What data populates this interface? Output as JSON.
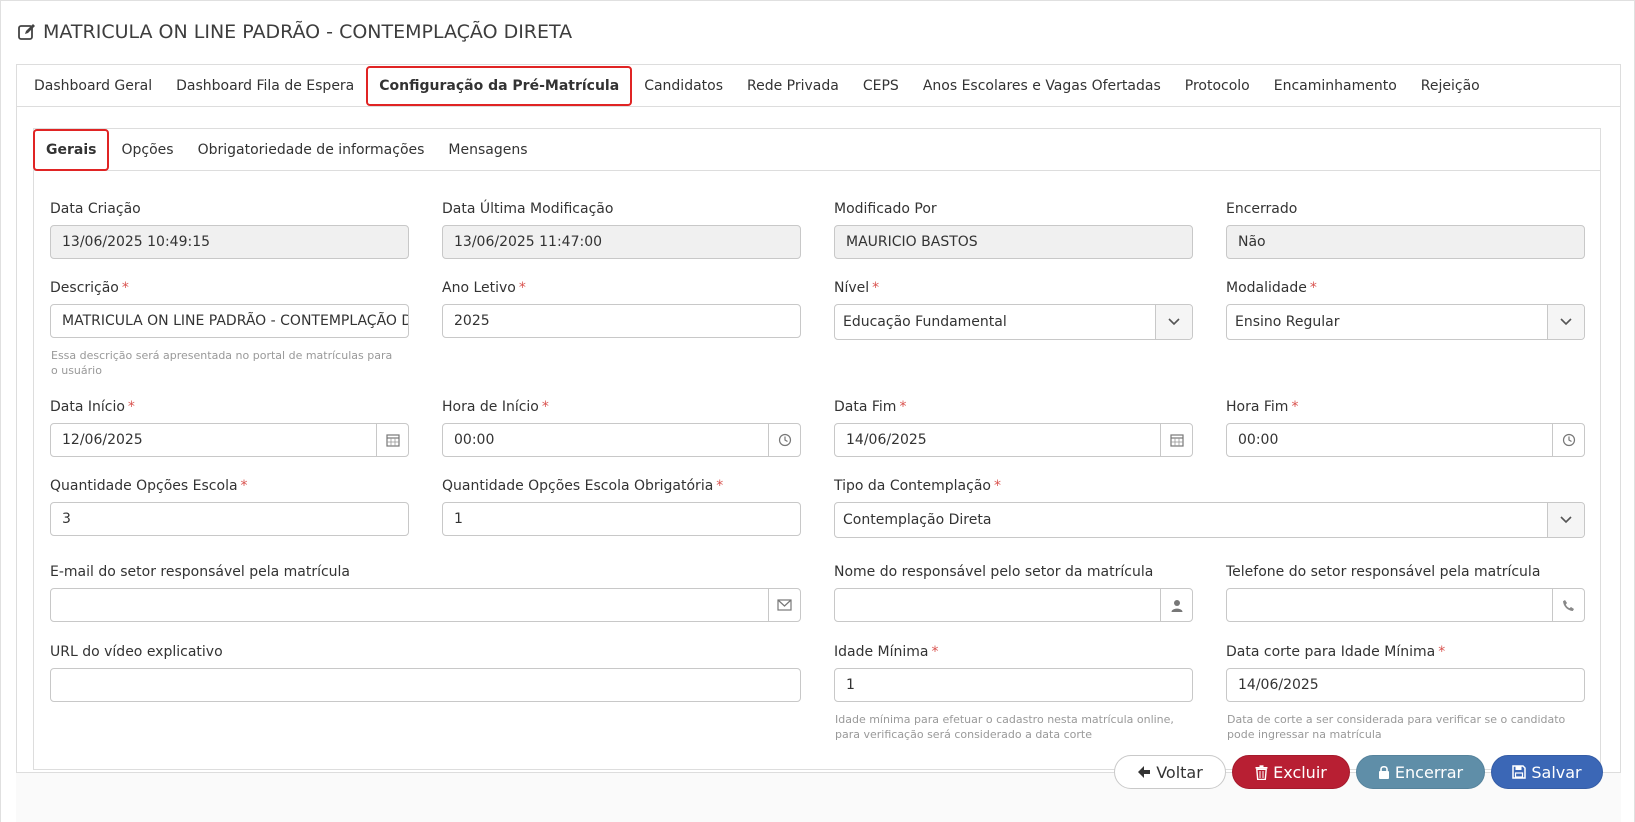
{
  "header": {
    "title": "MATRICULA ON LINE PADRÃO - CONTEMPLAÇÃO DIRETA",
    "icon": "edit-icon"
  },
  "tabs": [
    {
      "label": "Dashboard Geral"
    },
    {
      "label": "Dashboard Fila de Espera"
    },
    {
      "label": "Configuração da Pré-Matrícula",
      "active": true
    },
    {
      "label": "Candidatos"
    },
    {
      "label": "Rede Privada"
    },
    {
      "label": "CEPS"
    },
    {
      "label": "Anos Escolares e Vagas Ofertadas"
    },
    {
      "label": "Protocolo"
    },
    {
      "label": "Encaminhamento"
    },
    {
      "label": "Rejeição"
    }
  ],
  "subtabs": [
    {
      "label": "Gerais",
      "active": true
    },
    {
      "label": "Opções"
    },
    {
      "label": "Obrigatoriedade de informações"
    },
    {
      "label": "Mensagens"
    }
  ],
  "form": {
    "data_criacao": {
      "label": "Data Criação",
      "value": "13/06/2025 10:49:15"
    },
    "data_ultima_mod": {
      "label": "Data Última Modificação",
      "value": "13/06/2025 11:47:00"
    },
    "modificado_por": {
      "label": "Modificado Por",
      "value": "MAURICIO BASTOS"
    },
    "encerrado": {
      "label": "Encerrado",
      "value": "Não"
    },
    "descricao": {
      "label": "Descrição",
      "value": "MATRICULA ON LINE PADRÃO - CONTEMPLAÇÃO DIRETA",
      "help": "Essa descrição será apresentada no portal de matrículas para o usuário"
    },
    "ano_letivo": {
      "label": "Ano Letivo",
      "value": "2025"
    },
    "nivel": {
      "label": "Nível",
      "value": "Educação Fundamental"
    },
    "modalidade": {
      "label": "Modalidade",
      "value": "Ensino Regular"
    },
    "data_inicio": {
      "label": "Data Início",
      "value": "12/06/2025"
    },
    "hora_inicio": {
      "label": "Hora de Início",
      "value": "00:00"
    },
    "data_fim": {
      "label": "Data Fim",
      "value": "14/06/2025"
    },
    "hora_fim": {
      "label": "Hora Fim",
      "value": "00:00"
    },
    "qtd_opcoes": {
      "label": "Quantidade Opções Escola",
      "value": "3"
    },
    "qtd_opcoes_obrig": {
      "label": "Quantidade Opções Escola Obrigatória",
      "value": "1"
    },
    "tipo_contemplacao": {
      "label": "Tipo da Contemplação",
      "value": "Contemplação Direta"
    },
    "email_setor": {
      "label": "E-mail do setor responsável pela matrícula",
      "value": ""
    },
    "nome_responsavel": {
      "label": "Nome do responsável pelo setor da matrícula",
      "value": ""
    },
    "telefone_setor": {
      "label": "Telefone do setor responsável pela matrícula",
      "value": ""
    },
    "url_video": {
      "label": "URL do vídeo explicativo",
      "value": ""
    },
    "idade_minima": {
      "label": "Idade Mínima",
      "value": "1",
      "help": "Idade mínima para efetuar o cadastro nesta matrícula online, para verificação será considerado a data corte"
    },
    "data_corte": {
      "label": "Data corte para Idade Mínima",
      "value": "14/06/2025",
      "help": "Data de corte a ser considerada para verificar se o candidato pode ingressar na matrícula"
    },
    "required_mark": "*"
  },
  "buttons": {
    "voltar": "Voltar",
    "excluir": "Excluir",
    "encerrar": "Encerrar",
    "salvar": "Salvar"
  },
  "colors": {
    "active_outline": "#e02424",
    "required": "#d9534f",
    "excluir": "#b81f33",
    "encerrar": "#5f8ea8",
    "salvar": "#3b67b6"
  }
}
